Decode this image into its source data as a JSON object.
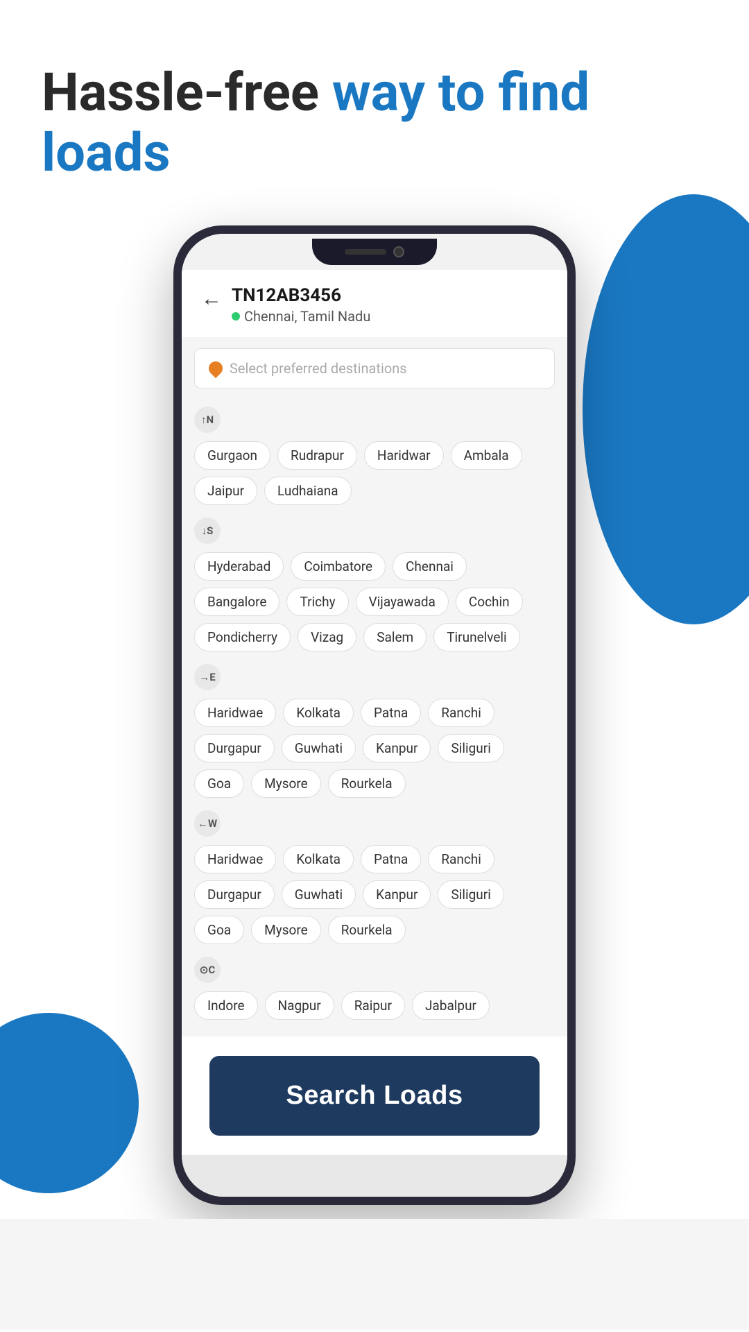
{
  "header": {
    "line1_plain": "Hassle-free ",
    "line1_blue": "way to find",
    "line2_blue": "loads"
  },
  "app": {
    "back_label": "←",
    "vehicle_id": "TN12AB3456",
    "vehicle_location": "Chennai, Tamil Nadu",
    "search_placeholder": "Select preferred destinations",
    "search_button_label": "Search Loads",
    "directions": [
      {
        "id": "north",
        "icon_label": "N",
        "icon_symbol": "↑N",
        "chips": [
          "Gurgaon",
          "Rudrapur",
          "Haridwar",
          "Ambala",
          "Jaipur",
          "Ludhaiana"
        ]
      },
      {
        "id": "south",
        "icon_label": "S",
        "icon_symbol": "↓S",
        "chips": [
          "Hyderabad",
          "Coimbatore",
          "Chennai",
          "Bangalore",
          "Trichy",
          "Vijayawada",
          "Cochin",
          "Pondicherry",
          "Vizag",
          "Salem",
          "Tirunelveli"
        ]
      },
      {
        "id": "east",
        "icon_label": "E",
        "icon_symbol": "→E",
        "chips": [
          "Haridwae",
          "Kolkata",
          "Patna",
          "Ranchi",
          "Durgapur",
          "Guwhati",
          "Kanpur",
          "Siliguri",
          "Goa",
          "Mysore",
          "Rourkela"
        ]
      },
      {
        "id": "west",
        "icon_label": "W",
        "icon_symbol": "←W",
        "chips": [
          "Haridwae",
          "Kolkata",
          "Patna",
          "Ranchi",
          "Durgapur",
          "Guwhati",
          "Kanpur",
          "Siliguri",
          "Goa",
          "Mysore",
          "Rourkela"
        ]
      },
      {
        "id": "central",
        "icon_label": "C",
        "icon_symbol": "⊙C",
        "chips": [
          "Indore",
          "Nagpur",
          "Raipur",
          "Jabalpur"
        ]
      }
    ]
  }
}
